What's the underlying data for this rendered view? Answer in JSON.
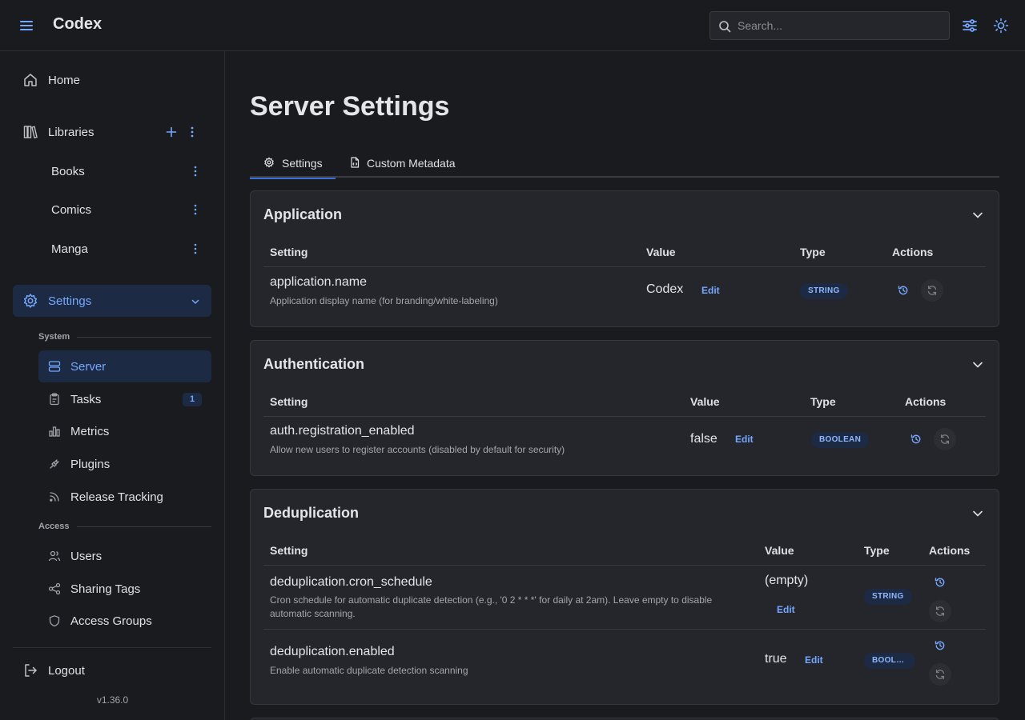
{
  "header": {
    "app_title": "Codex",
    "search_placeholder": "Search...",
    "menu_icon": "hamburger-icon",
    "filter_icon": "sliders-icon",
    "theme_icon": "sun-icon"
  },
  "sidebar": {
    "home": "Home",
    "libraries": "Libraries",
    "library_items": [
      "Books",
      "Comics",
      "Manga"
    ],
    "settings": "Settings",
    "system_label": "System",
    "system_items": [
      {
        "label": "Server",
        "icon": "server-icon"
      },
      {
        "label": "Tasks",
        "icon": "clipboard-icon",
        "badge": "1"
      },
      {
        "label": "Metrics",
        "icon": "bar-chart-icon"
      },
      {
        "label": "Plugins",
        "icon": "plug-icon"
      },
      {
        "label": "Release Tracking",
        "icon": "rss-icon"
      }
    ],
    "access_label": "Access",
    "access_items": [
      {
        "label": "Users",
        "icon": "users-icon"
      },
      {
        "label": "Sharing Tags",
        "icon": "share-icon"
      },
      {
        "label": "Access Groups",
        "icon": "shield-icon"
      }
    ],
    "logout": "Logout",
    "version": "v1.36.0"
  },
  "main": {
    "page_title": "Server Settings",
    "tabs": [
      {
        "label": "Settings",
        "icon": "gear-icon",
        "active": true
      },
      {
        "label": "Custom Metadata",
        "icon": "file-code-icon",
        "active": false
      }
    ],
    "columns": {
      "setting": "Setting",
      "value": "Value",
      "type": "Type",
      "actions": "Actions"
    },
    "edit_label": "Edit",
    "sections": [
      {
        "title": "Application",
        "rows": [
          {
            "key": "application.name",
            "description": "Application display name (for branding/white-labeling)",
            "value": "Codex",
            "type": "STRING"
          }
        ]
      },
      {
        "title": "Authentication",
        "rows": [
          {
            "key": "auth.registration_enabled",
            "description": "Allow new users to register accounts (disabled by default for security)",
            "value": "false",
            "type": "BOOLEAN"
          }
        ]
      },
      {
        "title": "Deduplication",
        "rows": [
          {
            "key": "deduplication.cron_schedule",
            "description": "Cron schedule for automatic duplicate detection (e.g., '0 2 * * *' for daily at 2am). Leave empty to disable automatic scanning.",
            "value": "(empty)",
            "type": "STRING"
          },
          {
            "key": "deduplication.enabled",
            "description": "Enable automatic duplicate detection scanning",
            "value": "true",
            "type": "BOOLE..."
          }
        ]
      }
    ]
  },
  "colors": {
    "accent": "#74a8ff",
    "background": "#1a1b1e",
    "card": "#25262b",
    "active_bg": "#1d2a44"
  }
}
